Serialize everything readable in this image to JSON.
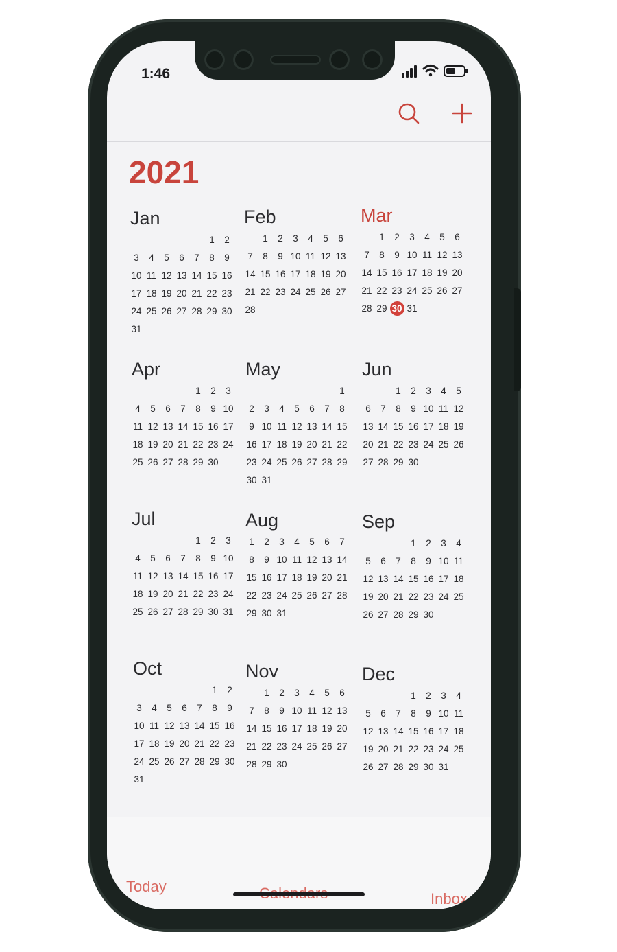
{
  "status_bar": {
    "time": "1:46"
  },
  "toolbar": {
    "search_icon": "search-icon",
    "add_icon": "plus-icon",
    "accent": "#c8443c"
  },
  "year": "2021",
  "today": {
    "month_index": 2,
    "day": 30
  },
  "months": [
    {
      "name": "Jan",
      "start": 5,
      "days": 31
    },
    {
      "name": "Feb",
      "start": 1,
      "days": 28
    },
    {
      "name": "Mar",
      "start": 1,
      "days": 31
    },
    {
      "name": "Apr",
      "start": 4,
      "days": 30
    },
    {
      "name": "May",
      "start": 6,
      "days": 31
    },
    {
      "name": "Jun",
      "start": 2,
      "days": 30
    },
    {
      "name": "Jul",
      "start": 4,
      "days": 31
    },
    {
      "name": "Aug",
      "start": 0,
      "days": 31
    },
    {
      "name": "Sep",
      "start": 3,
      "days": 30
    },
    {
      "name": "Oct",
      "start": 5,
      "days": 31
    },
    {
      "name": "Nov",
      "start": 1,
      "days": 30
    },
    {
      "name": "Dec",
      "start": 3,
      "days": 31
    }
  ],
  "tabs": [
    {
      "label": "Today"
    },
    {
      "label": "Calendars"
    },
    {
      "label": "Inbox"
    }
  ]
}
